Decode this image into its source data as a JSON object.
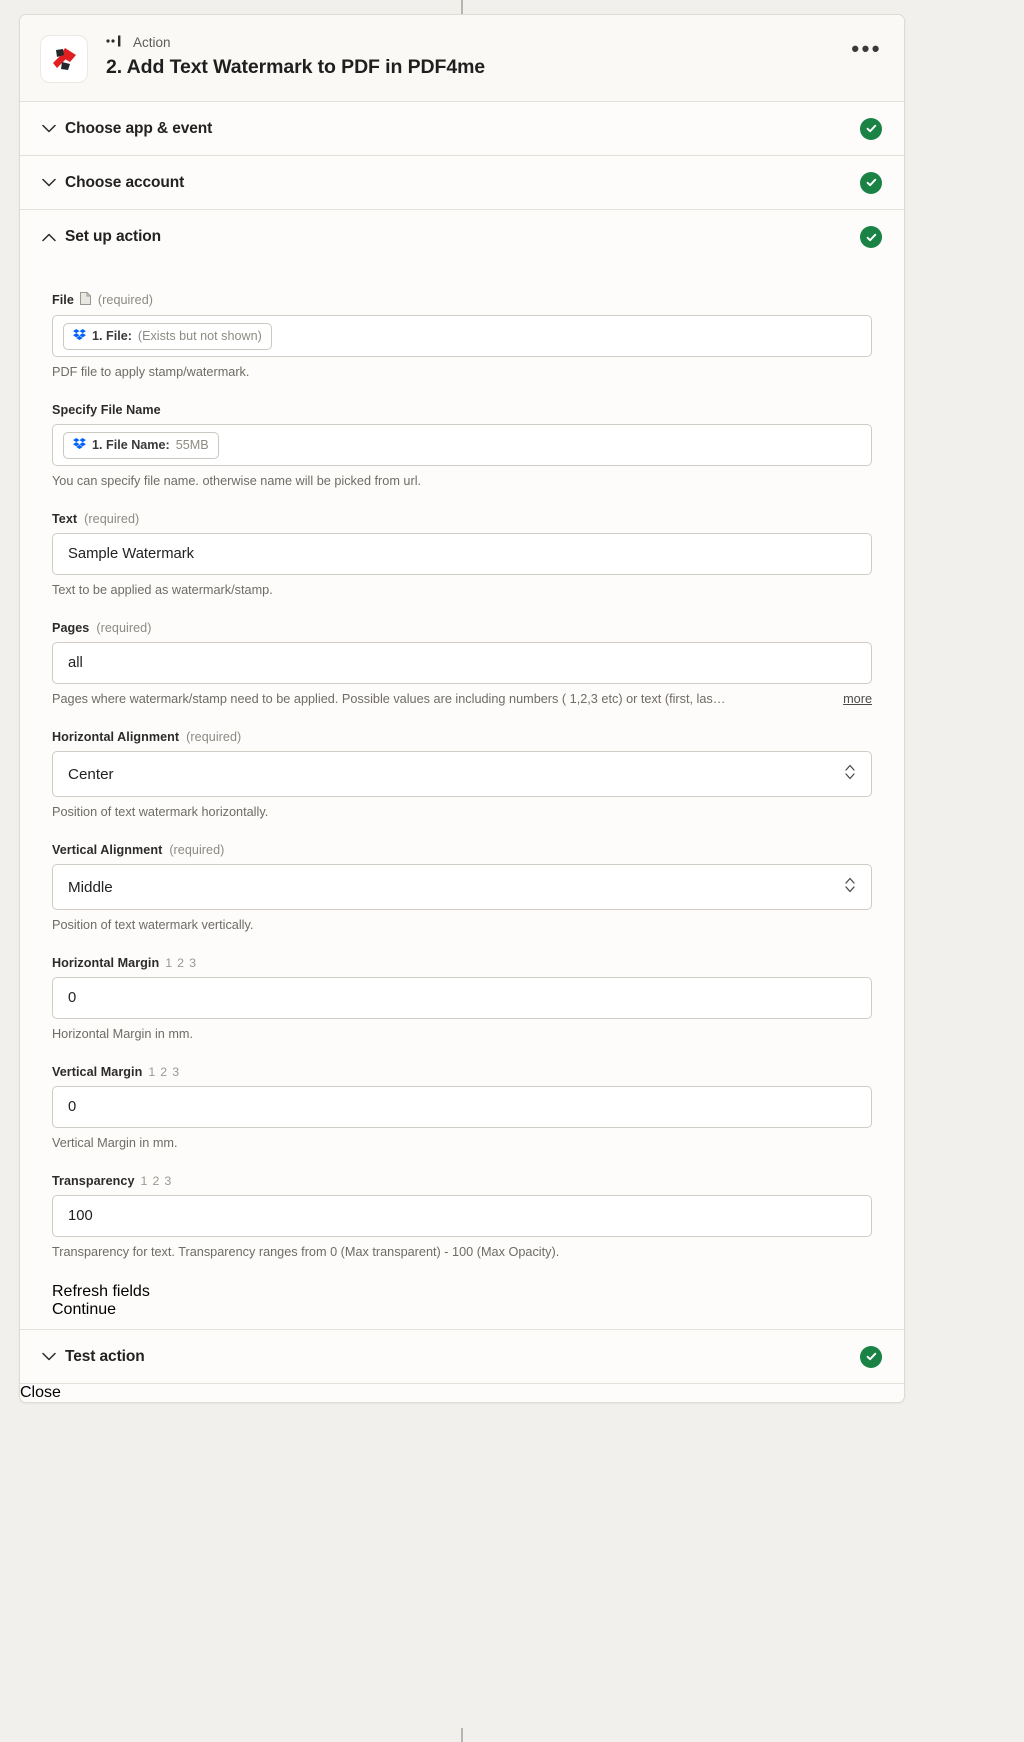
{
  "header": {
    "app_icon": "pdf4me-logo-icon",
    "kicker": "Action",
    "title": "2. Add Text Watermark to PDF in PDF4me",
    "menu_icon": "ellipsis-icon"
  },
  "sections": [
    {
      "label": "Choose app & event",
      "state": "collapsed",
      "status": "complete"
    },
    {
      "label": "Choose account",
      "state": "collapsed",
      "status": "complete"
    },
    {
      "label": "Set up action",
      "state": "expanded",
      "status": "complete"
    },
    {
      "label": "Test action",
      "state": "collapsed",
      "status": "complete"
    }
  ],
  "fields": [
    {
      "label": "File",
      "required_text": "(required)",
      "has_file_icon": true,
      "type": "token",
      "token_icon": "dropbox-icon",
      "token_label": "1. File:",
      "token_value": "(Exists but not shown)",
      "help": "PDF file to apply stamp/watermark."
    },
    {
      "label": "Specify File Name",
      "required_text": "",
      "type": "token",
      "token_icon": "dropbox-icon",
      "token_label": "1. File Name:",
      "token_value": "55MB",
      "help": "You can specify file name. otherwise name will be picked from url."
    },
    {
      "label": "Text",
      "required_text": "(required)",
      "type": "text",
      "value": "Sample Watermark",
      "help": "Text to be applied as watermark/stamp."
    },
    {
      "label": "Pages",
      "required_text": "(required)",
      "type": "text",
      "value": "all",
      "help": "Pages where watermark/stamp need to be applied. Possible values are including numbers ( 1,2,3 etc) or text (first, las…",
      "more_label": "more"
    },
    {
      "label": "Horizontal Alignment",
      "required_text": "(required)",
      "type": "select",
      "value": "Center",
      "help": "Position of text watermark horizontally."
    },
    {
      "label": "Vertical Alignment",
      "required_text": "(required)",
      "type": "select",
      "value": "Middle",
      "help": "Position of text watermark vertically."
    },
    {
      "label": "Horizontal Margin",
      "type_hint": "1 2 3",
      "type": "text",
      "value": "0",
      "help": "Horizontal Margin in mm."
    },
    {
      "label": "Vertical Margin",
      "type_hint": "1 2 3",
      "type": "text",
      "value": "0",
      "help": "Vertical Margin in mm."
    },
    {
      "label": "Transparency",
      "type_hint": "1 2 3",
      "type": "text",
      "value": "100",
      "help": "Transparency for text. Transparency ranges from 0 (Max transparent) - 100 (Max Opacity)."
    }
  ],
  "buttons": {
    "refresh_label": "Refresh fields",
    "continue_label": "Continue"
  },
  "footer": {
    "close_label": "Close"
  },
  "colors": {
    "primary": "#34348a",
    "success": "#1a8245",
    "page_bg": "#f1f0ec",
    "card_bg": "#fdfcfa"
  }
}
